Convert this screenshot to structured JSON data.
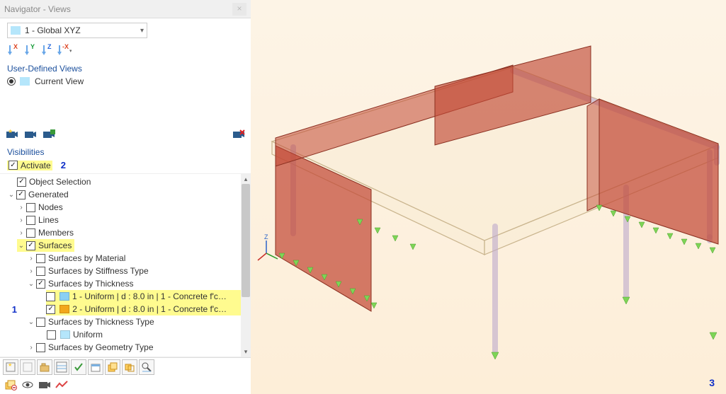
{
  "title": "Navigator - Views",
  "globalViewDropdown": "1 - Global XYZ",
  "axisButtons": [
    "X",
    "Y",
    "Z",
    "-X"
  ],
  "sections": {
    "userDefined": "User-Defined Views",
    "currentView": "Current View",
    "visibilities": "Visibilities",
    "activate": "Activate"
  },
  "annotations": {
    "a1": "1",
    "a2": "2",
    "a3": "3"
  },
  "tree": {
    "objectSelection": "Object Selection",
    "generated": "Generated",
    "nodes": "Nodes",
    "lines": "Lines",
    "members": "Members",
    "surfaces": "Surfaces",
    "surfByMaterial": "Surfaces by Material",
    "surfByStiffness": "Surfaces by Stiffness Type",
    "surfByThickness": "Surfaces by Thickness",
    "thick1": "1 - Uniform | d : 8.0 in | 1 - Concrete f'c =...",
    "thick2": "2 - Uniform | d : 8.0 in | 1 - Concrete f'c =...",
    "surfByThicknessType": "Surfaces by Thickness Type",
    "uniform": "Uniform",
    "surfByGeometry": "Surfaces by Geometry Type"
  },
  "colors": {
    "swatch1": "#8ad0f4",
    "swatch2": "#f2a71b"
  }
}
